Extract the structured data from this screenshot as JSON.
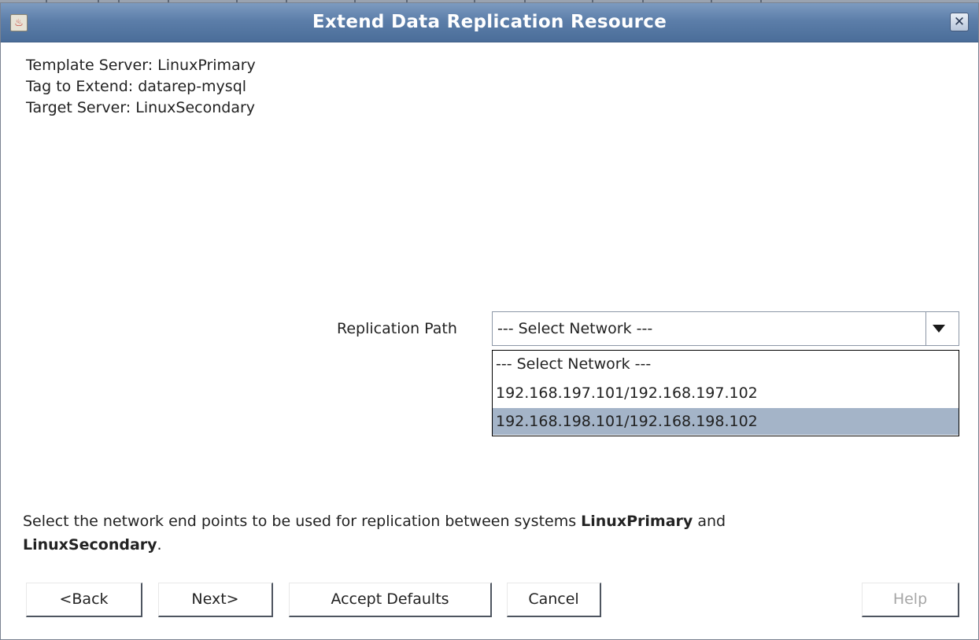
{
  "window": {
    "title": "Extend Data Replication Resource",
    "app_icon": "java-icon",
    "close_icon": "close-icon"
  },
  "info": {
    "template_server": "Template Server: LinuxPrimary",
    "tag_to_extend": "Tag to Extend: datarep-mysql",
    "target_server": "Target Server: LinuxSecondary"
  },
  "replication": {
    "label": "Replication Path",
    "selected": "--- Select Network ---",
    "options": [
      "--- Select Network ---",
      "192.168.197.101/192.168.197.102",
      "192.168.198.101/192.168.198.102"
    ],
    "highlighted_option": "192.168.198.101/192.168.198.102"
  },
  "description": {
    "text_before": "Select the network end points to be used for replication between systems ",
    "primary": "LinuxPrimary",
    "text_middle": " and ",
    "secondary": "LinuxSecondary",
    "text_after": "."
  },
  "buttons": {
    "back": "<Back",
    "next": "Next>",
    "accept_defaults": "Accept Defaults",
    "cancel": "Cancel",
    "help": "Help"
  },
  "colors": {
    "titlebar": "#5c7ea9",
    "selection_highlight": "#a4b4c8",
    "disabled_text": "#a6a6a6"
  }
}
